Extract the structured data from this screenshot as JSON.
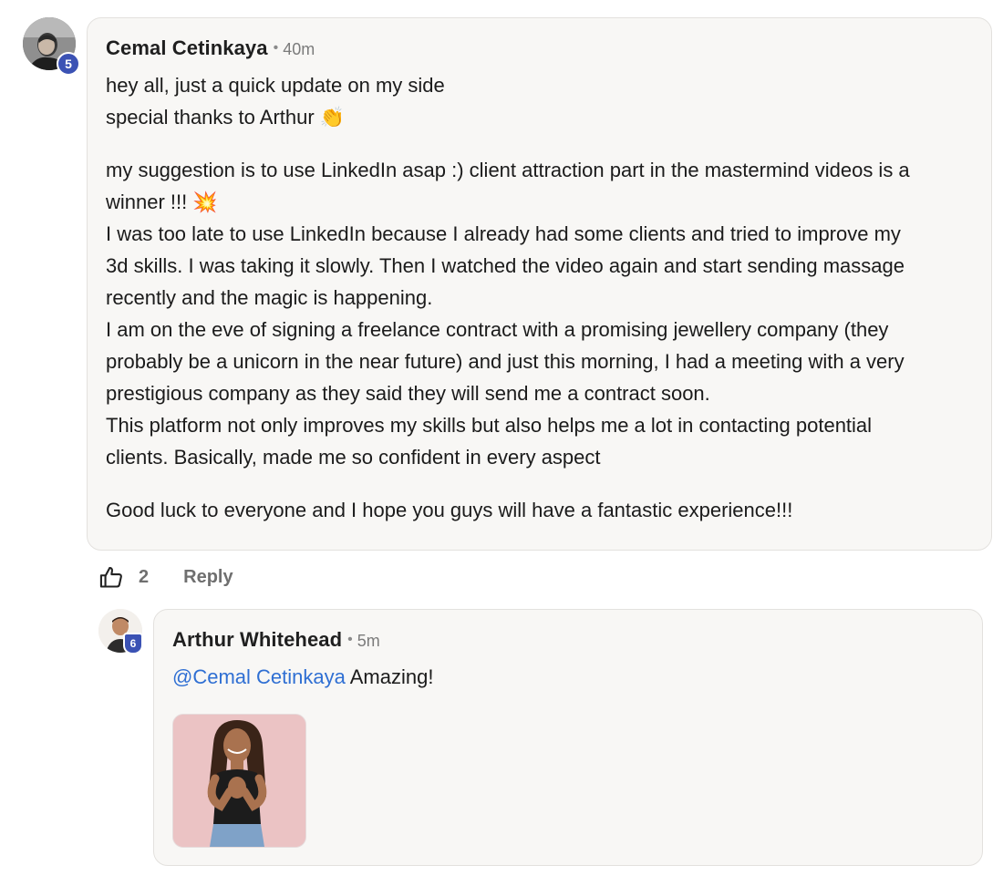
{
  "comment": {
    "author": "Cemal Cetinkaya",
    "separator": "•",
    "time": "40m",
    "level": "5",
    "paragraph1": [
      "hey all, just a quick update on my side",
      "special thanks to Arthur 👏"
    ],
    "paragraph2": [
      "my suggestion is to use LinkedIn asap :) client attraction part in the mastermind videos is a",
      "winner !!! 💥",
      "I was too late to use LinkedIn because I already had some clients and tried to improve my",
      "3d skills. I was taking it slowly. Then I watched the video again and start sending massage",
      "recently and the magic is happening.",
      "I am on the eve of signing a freelance contract with a promising jewellery company (they",
      "probably be a unicorn in the near future) and just this morning, I had a meeting with a very",
      "prestigious company as they said they will send me a contract soon.",
      "This platform not only improves my skills but also helps me a lot in contacting potential",
      "clients. Basically, made me so confident in every aspect"
    ],
    "paragraph3": "Good luck to everyone and I hope you guys will have a fantastic experience!!!",
    "likes": "2",
    "reply_label": "Reply"
  },
  "reply": {
    "author": "Arthur Whitehead",
    "separator": "•",
    "time": "5m",
    "level": "6",
    "mention": "@Cemal Cetinkaya",
    "text": " Amazing!"
  },
  "colors": {
    "accent": "#2f6fd3",
    "bubble_bg": "#f8f7f5",
    "badge_blue": "#3b52b4",
    "muted": "#6f6f6f"
  },
  "icons": {
    "like": "thumbs-up-icon"
  }
}
